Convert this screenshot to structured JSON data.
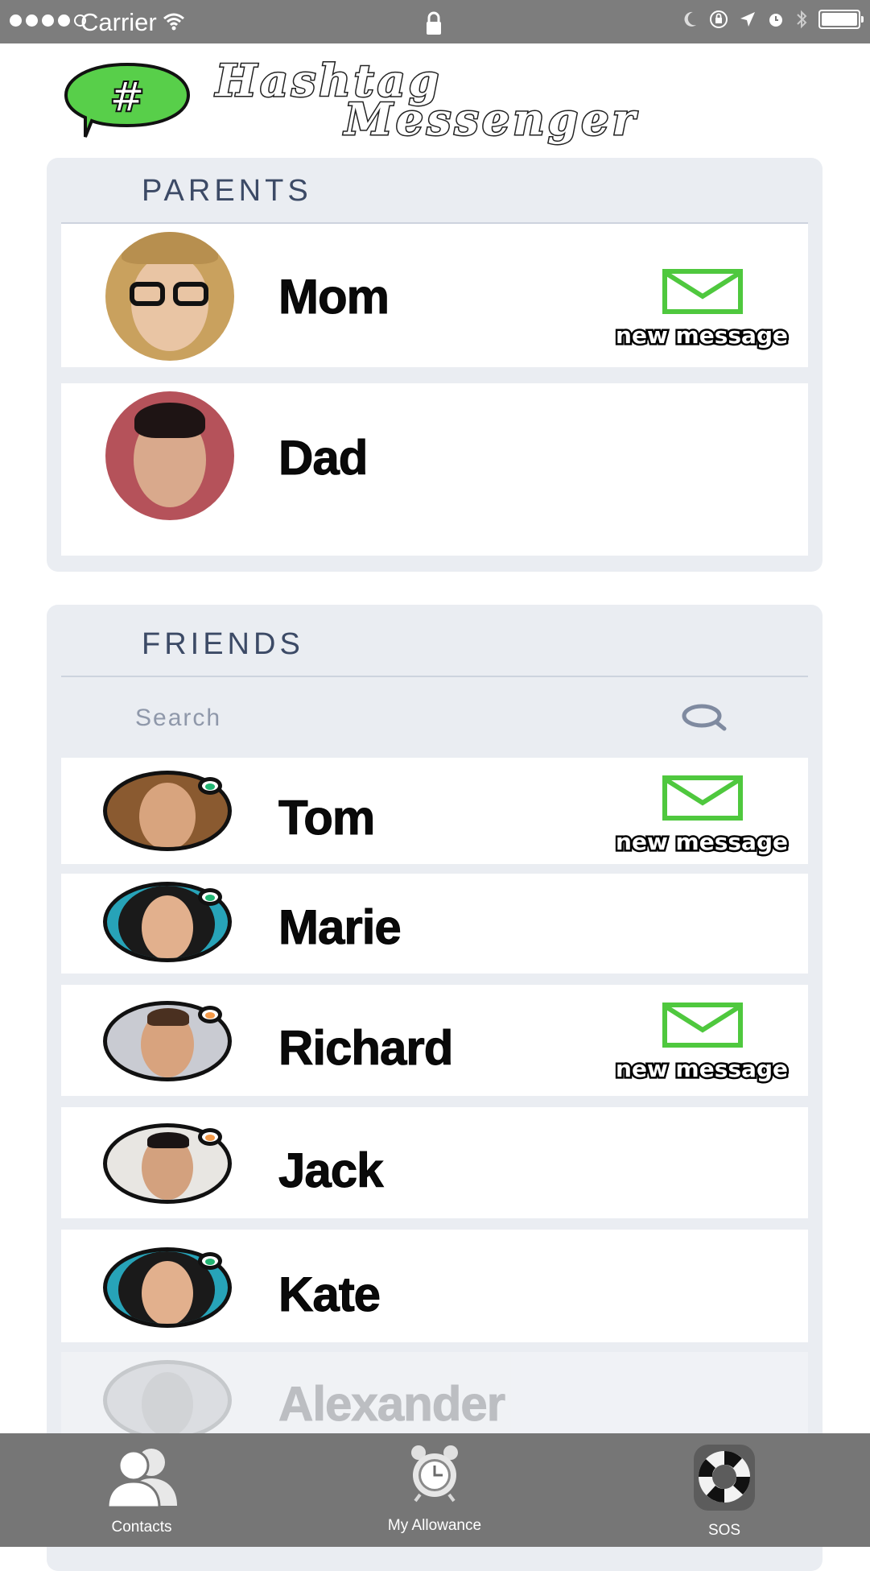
{
  "status_bar": {
    "carrier": "Carrier"
  },
  "header": {
    "logo_symbol": "#",
    "title_line1": "Hashtag",
    "title_line2": "Messenger"
  },
  "parents": {
    "title": "PARENTS",
    "contacts": [
      {
        "name": "Mom",
        "new_message": "new message"
      },
      {
        "name": "Dad",
        "new_message": ""
      }
    ]
  },
  "friends": {
    "title": "FRIENDS",
    "search_placeholder": "Search",
    "contacts": [
      {
        "name": "Tom",
        "status_color": "#22b573",
        "new_message": "new message"
      },
      {
        "name": "Marie",
        "status_color": "#22b573",
        "new_message": ""
      },
      {
        "name": "Richard",
        "status_color": "#f39a4a",
        "new_message": "new message"
      },
      {
        "name": "Jack",
        "status_color": "#f39a4a",
        "new_message": ""
      },
      {
        "name": "Kate",
        "status_color": "#22b573",
        "new_message": ""
      },
      {
        "name": "Alexander",
        "status_color": "",
        "new_message": ""
      }
    ]
  },
  "tab_bar": {
    "tabs": [
      {
        "label": "Contacts",
        "icon": "contacts-icon"
      },
      {
        "label": "My Allowance",
        "icon": "alarm-clock-icon"
      },
      {
        "label": "SOS",
        "icon": "lifebuoy-icon"
      }
    ]
  },
  "colors": {
    "accent_green": "#4fc83e",
    "section_bg": "#eaedf2",
    "section_title": "#3c4a66",
    "tab_bar_bg": "#767676"
  }
}
